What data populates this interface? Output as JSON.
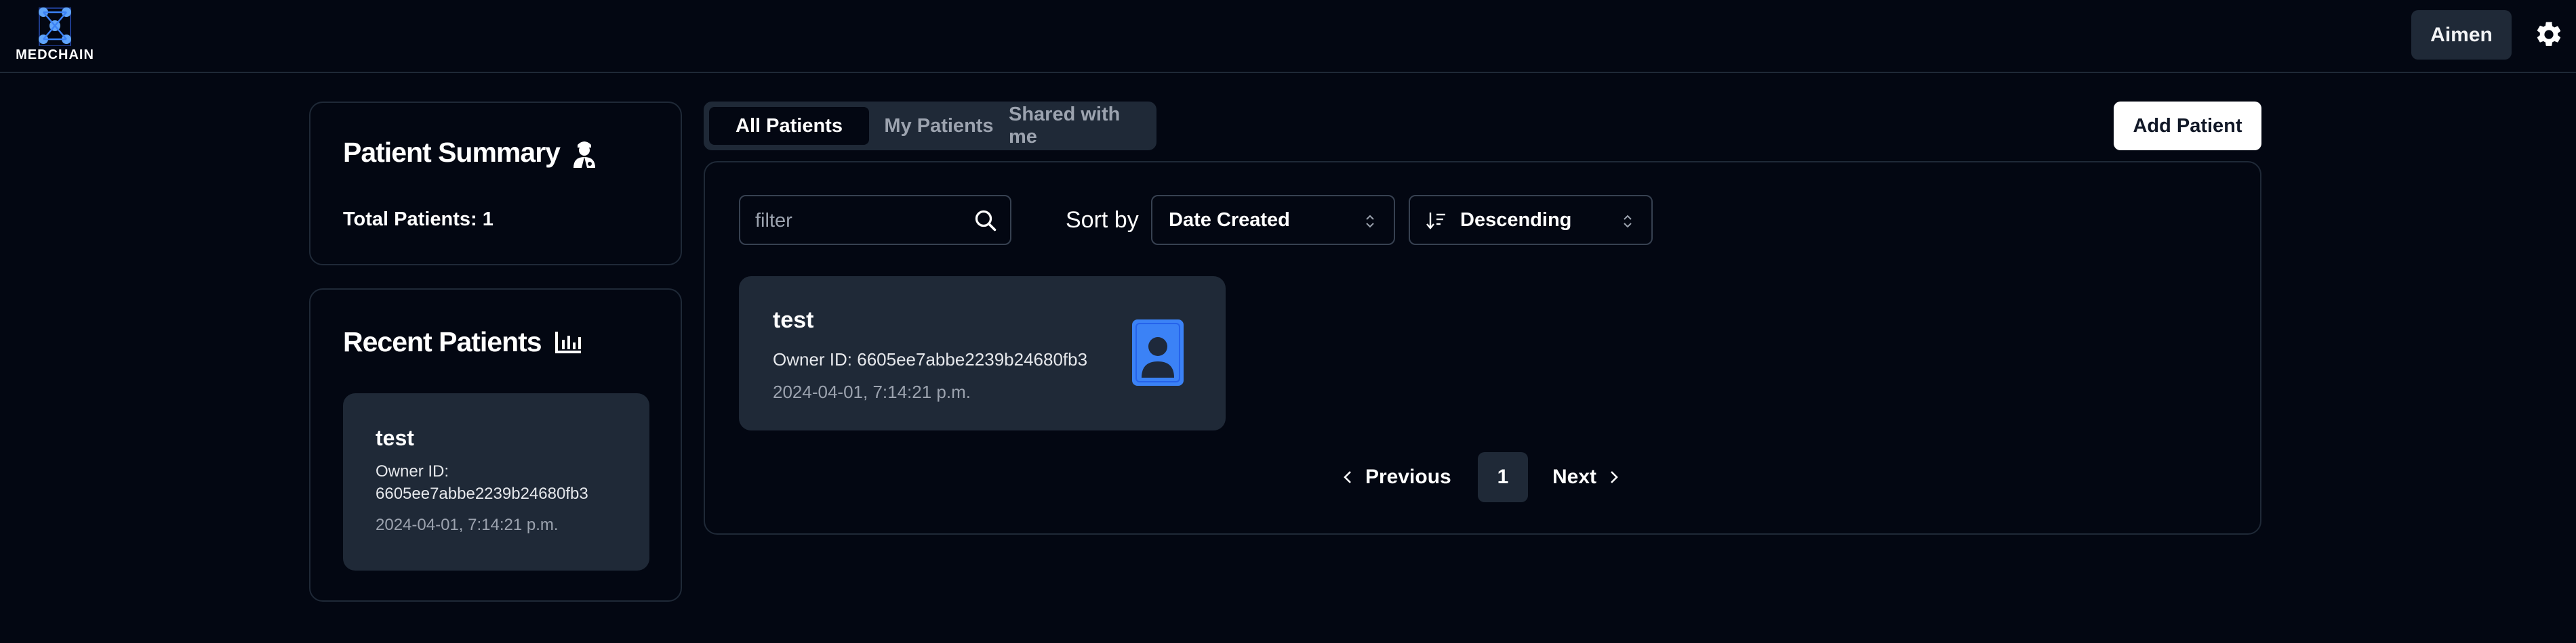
{
  "header": {
    "logo_text": "MEDCHAIN",
    "user_button": "Aimen",
    "settings_icon": "gear-icon"
  },
  "summary": {
    "title": "Patient Summary",
    "title_icon": "doctor-icon",
    "total": "Total Patients: 1"
  },
  "recent": {
    "title": "Recent Patients",
    "title_icon": "bar-chart-icon",
    "items": [
      {
        "name": "test",
        "owner_label": "Owner ID:",
        "owner_id": "6605ee7abbe2239b24680fb3",
        "date": "2024-04-01, 7:14:21 p.m."
      }
    ]
  },
  "tabs": [
    "All Patients",
    "My Patients",
    "Shared with me"
  ],
  "active_tab": "All Patients",
  "add_button": "Add Patient",
  "toolbar": {
    "filter_placeholder": "filter",
    "sort_by_label": "Sort by",
    "sort_field": "Date Created",
    "sort_order": "Descending"
  },
  "patients": [
    {
      "name": "test",
      "owner": "Owner ID: 6605ee7abbe2239b24680fb3",
      "date": "2024-04-01, 7:14:21 p.m."
    }
  ],
  "pagination": {
    "previous": "Previous",
    "current_page": "1",
    "next": "Next"
  },
  "colors": {
    "background": "#030712",
    "surface": "#1f2937",
    "border": "#1f2937",
    "avatar_blue": "#3b82f6"
  }
}
